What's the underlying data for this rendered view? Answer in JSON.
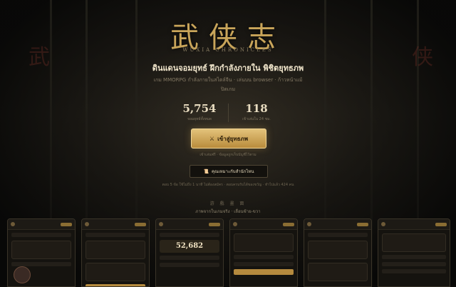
{
  "hero": {
    "title_cn": "武侠志",
    "title_en": "WUXIA CHRONICLES",
    "side_left": "武",
    "side_right": "侠",
    "headline": "ดินแดนจอมยุทธ์ ฝึกกำลังภายใน พิชิตยุทธภพ",
    "subline": "เกม MMORPG กำลังภายในสไตล์จีน · เล่นบน browser · ก้าวหน้าแม้ปิดเกม"
  },
  "stats": [
    {
      "value": "5,754",
      "label": "จอมยุทธ์ทั้งหมด"
    },
    {
      "value": "118",
      "label": "เข้าเล่นใน 24 ชม."
    }
  ],
  "cta": {
    "icon": "crossed-swords-icon",
    "label": "เข้าสู่ยุทธภพ",
    "note": "เข้าเล่นฟรี · ข้อมูลถูกเก็บบัญชีไว้ตาม"
  },
  "quiz": {
    "icon": "scroll-icon",
    "label": "คุณเหมาะกับสำนักไหน",
    "note": "ตอบ 5 ข้อ ใช้ไม่ถึง 1 นาที ไม่ต้องสมัคร · ตอบครบรับได้ของขวัญ · ทำไปแล้ว 424 คน"
  },
  "gallery": {
    "section_cn": "游 戲 畫 面",
    "subtitle": "ภาพจากในเกมจริง · เลื่อนซ้าย-ขวา",
    "featured_value": "52,682"
  }
}
